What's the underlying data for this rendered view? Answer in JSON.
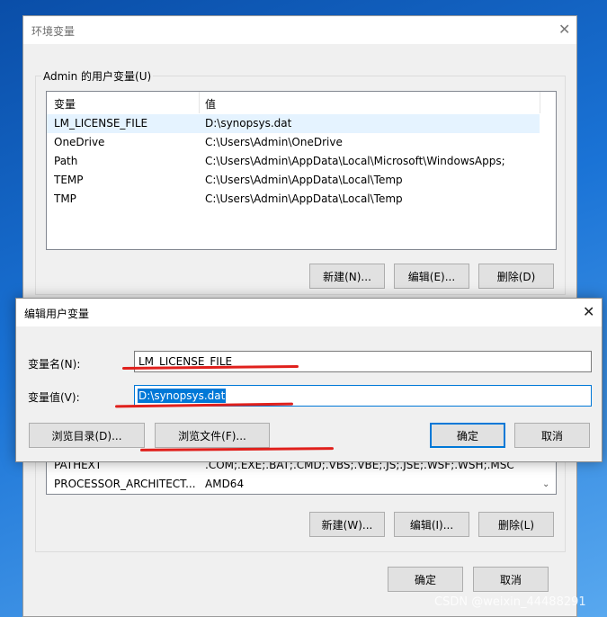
{
  "env_dialog": {
    "title": "环境变量",
    "user_group_label": "Admin 的用户变量(U)",
    "columns": [
      "变量",
      "值"
    ],
    "user_vars": [
      {
        "name": "LM_LICENSE_FILE",
        "value": "D:\\synopsys.dat"
      },
      {
        "name": "OneDrive",
        "value": "C:\\Users\\Admin\\OneDrive"
      },
      {
        "name": "Path",
        "value": "C:\\Users\\Admin\\AppData\\Local\\Microsoft\\WindowsApps;"
      },
      {
        "name": "TEMP",
        "value": "C:\\Users\\Admin\\AppData\\Local\\Temp"
      },
      {
        "name": "TMP",
        "value": "C:\\Users\\Admin\\AppData\\Local\\Temp"
      }
    ],
    "user_buttons": {
      "new": "新建(N)...",
      "edit": "编辑(E)...",
      "delete": "删除(D)"
    },
    "system_vars": [
      {
        "name": "PATHEXT",
        "value": ".COM;.EXE;.BAT;.CMD;.VBS;.VBE;.JS;.JSE;.WSF;.WSH;.MSC"
      },
      {
        "name": "PROCESSOR_ARCHITECT...",
        "value": "AMD64"
      }
    ],
    "system_buttons": {
      "new": "新建(W)...",
      "edit": "编辑(I)...",
      "delete": "删除(L)"
    },
    "ok": "确定",
    "cancel": "取消"
  },
  "edit_dialog": {
    "title": "编辑用户变量",
    "name_label": "变量名(N):",
    "name_value": "LM_LICENSE_FILE",
    "value_label": "变量值(V):",
    "value_value": "D:\\synopsys.dat",
    "browse_dir": "浏览目录(D)...",
    "browse_file": "浏览文件(F)...",
    "ok": "确定",
    "cancel": "取消"
  },
  "icons": {
    "close": "close-icon",
    "scroll_down": "chevron-down-icon"
  },
  "colors": {
    "accent": "#0078d7",
    "annotation": "#e0201c",
    "selection": "#e5f3ff"
  },
  "watermark": "CSDN @weixin_44488291"
}
